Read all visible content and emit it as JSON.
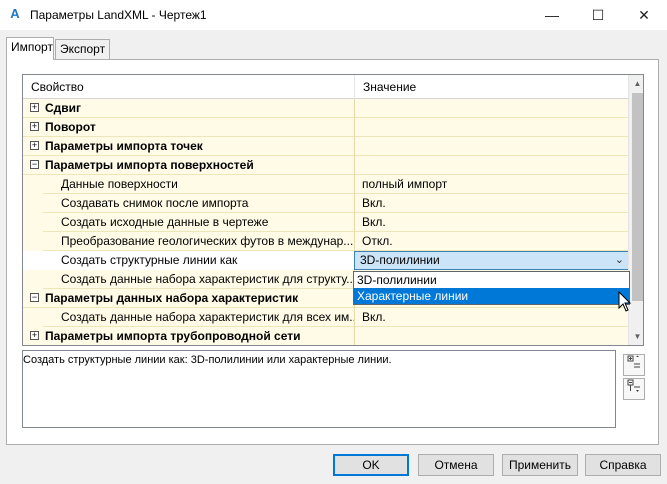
{
  "window": {
    "title": "Параметры LandXML - Чертеж1",
    "app_icon": "A",
    "minimize_glyph": "—",
    "maximize_glyph": "☐",
    "close_glyph": "✕"
  },
  "tabs": [
    {
      "label": "Импорт",
      "active": true
    },
    {
      "label": "Экспорт",
      "active": false
    }
  ],
  "grid": {
    "header": {
      "property": "Свойство",
      "value": "Значение"
    },
    "rows": [
      {
        "type": "category",
        "expander": "+",
        "name": "Сдвиг",
        "value": ""
      },
      {
        "type": "category",
        "expander": "+",
        "name": "Поворот",
        "value": ""
      },
      {
        "type": "category",
        "expander": "+",
        "name": "Параметры импорта точек",
        "value": ""
      },
      {
        "type": "category",
        "expander": "−",
        "name": "Параметры импорта поверхностей",
        "value": ""
      },
      {
        "type": "property",
        "name": "Данные поверхности",
        "value": "полный импорт"
      },
      {
        "type": "property",
        "name": "Создавать снимок после импорта",
        "value": "Вкл."
      },
      {
        "type": "property",
        "name": "Создать исходные данные в чертеже",
        "value": "Вкл."
      },
      {
        "type": "property",
        "name": "Преобразование геологических футов в междунар...",
        "value": "Откл."
      },
      {
        "type": "property",
        "name": "Создать структурные линии как",
        "value": "3D-полилинии",
        "selected": true
      },
      {
        "type": "property",
        "name": "Создать данные набора характеристик для структу...",
        "value": ""
      },
      {
        "type": "category",
        "expander": "−",
        "name": "Параметры данных набора характеристик",
        "value": ""
      },
      {
        "type": "property",
        "name": "Создать данные набора характеристик для всех им...",
        "value": "Вкл."
      },
      {
        "type": "category",
        "expander": "+",
        "name": "Параметры импорта трубопроводной сети",
        "value": ""
      }
    ],
    "dropdown_options": [
      {
        "label": "3D-полилинии",
        "selected": false
      },
      {
        "label": "Характерные линии",
        "selected": true
      }
    ]
  },
  "description": "Создать структурные линии как: 3D-полилинии или характерные линии.",
  "buttons": {
    "ok": "OK",
    "cancel": "Отмена",
    "apply": "Применить",
    "help": "Справка"
  },
  "colors": {
    "category_bg": "#fffbe6",
    "selection": "#0078d7",
    "combo_bg": "#cce4f7"
  }
}
